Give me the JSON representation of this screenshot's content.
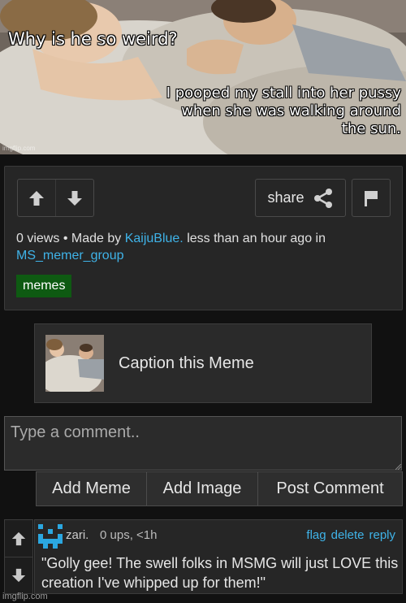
{
  "meme": {
    "top_text": "Why is he so weird?",
    "bottom_text": "I pooped my stall into her pussy when she was walking around the sun.",
    "watermark": "imgflip.com"
  },
  "post": {
    "share_label": "share",
    "views": "0 views",
    "separator": "•",
    "made_by_prefix": "Made by",
    "author": "KaijuBlue.",
    "time_text": "less than an hour ago in",
    "stream": "MS_memer_group",
    "tag": "memes"
  },
  "caption_box": {
    "label": "Caption this Meme"
  },
  "comment_form": {
    "placeholder": "Type a comment..",
    "buttons": [
      "Add Meme",
      "Add Image",
      "Post Comment"
    ]
  },
  "comment": {
    "username": "zari.",
    "meta": "0 ups, <1h",
    "actions": [
      "flag",
      "delete",
      "reply"
    ],
    "text": "\"Golly gee! The swell folks in MSMG will just LOVE this creation I've whipped up for them!\""
  },
  "footer": {
    "watermark": "imgflip.com"
  },
  "colors": {
    "link": "#3fb3e8",
    "tag_bg": "#0e5a12",
    "background": "#111111",
    "panel": "#262626"
  },
  "icons": [
    "upvote-arrow-icon",
    "downvote-arrow-icon",
    "share-icon",
    "flag-icon",
    "user-avatar-icon",
    "resize-grip-icon"
  ]
}
